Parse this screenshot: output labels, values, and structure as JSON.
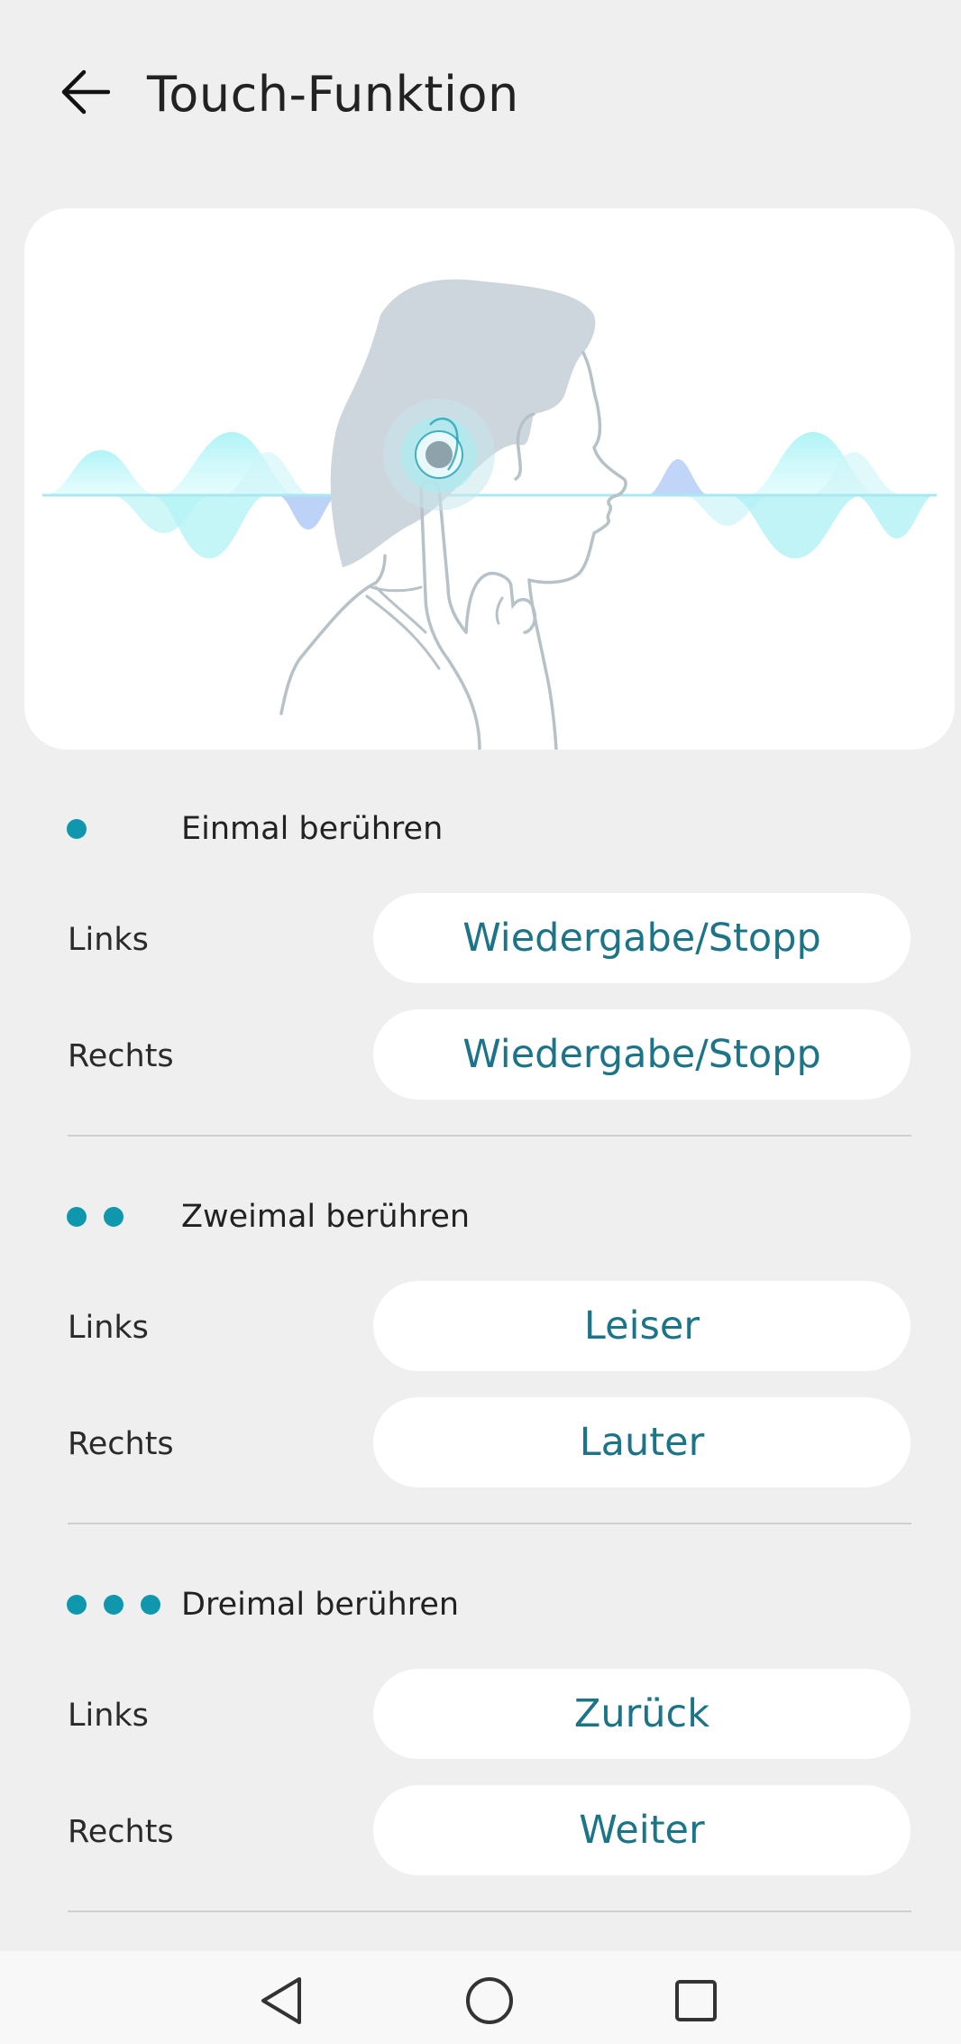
{
  "header": {
    "title": "Touch-Funktion",
    "back_icon": "arrow-left-icon"
  },
  "illustration": {
    "description_icon": "head-touch-earbud-illustration",
    "accent_color": "#a8f0f4",
    "wave_accent_color": "#a9c4f5"
  },
  "sections": [
    {
      "title": "Einmal berühren",
      "dot_count": 1,
      "rows": [
        {
          "label": "Links",
          "action": "Wiedergabe/Stopp"
        },
        {
          "label": "Rechts",
          "action": "Wiedergabe/Stopp"
        }
      ]
    },
    {
      "title": "Zweimal berühren",
      "dot_count": 2,
      "rows": [
        {
          "label": "Links",
          "action": "Leiser"
        },
        {
          "label": "Rechts",
          "action": "Lauter"
        }
      ]
    },
    {
      "title": "Dreimal berühren",
      "dot_count": 3,
      "rows": [
        {
          "label": "Links",
          "action": "Zurück"
        },
        {
          "label": "Rechts",
          "action": "Weiter"
        }
      ]
    }
  ],
  "colors": {
    "accent": "#0f98ad",
    "button_text": "#1c7488",
    "background": "#efefef",
    "card": "#ffffff"
  },
  "nav": {
    "back_icon": "triangle-back-icon",
    "home_icon": "circle-home-icon",
    "recents_icon": "square-recents-icon"
  }
}
